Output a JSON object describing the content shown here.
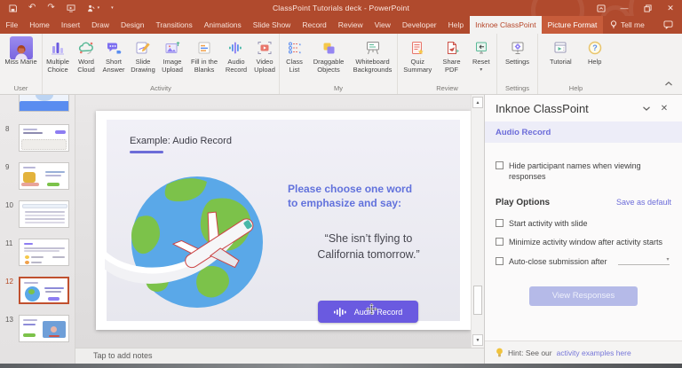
{
  "titlebar": {
    "title": "ClassPoint Tutorials deck  -  PowerPoint"
  },
  "tabs": {
    "items": [
      "File",
      "Home",
      "Insert",
      "Draw",
      "Design",
      "Transitions",
      "Animations",
      "Slide Show",
      "Record",
      "Review",
      "View",
      "Developer",
      "Help",
      "Inknoe ClassPoint",
      "Picture Format"
    ],
    "tellme": "Tell me"
  },
  "ribbon": {
    "group_labels": [
      "User",
      "Activity",
      "My",
      "Review",
      "Settings",
      "Help"
    ],
    "user": {
      "name": "Miss Marie"
    },
    "activity": [
      "Multiple Choice",
      "Word Cloud",
      "Short Answer",
      "Slide Drawing",
      "Image Upload",
      "Fill in the Blanks",
      "Audio Record",
      "Video Upload"
    ],
    "my": [
      "Class List",
      "Draggable Objects",
      "Whiteboard Backgrounds"
    ],
    "review": [
      "Quiz Summary",
      "Share PDF",
      "Reset"
    ],
    "settings": [
      "Settings"
    ],
    "help": [
      "Tutorial",
      "Help"
    ]
  },
  "thumbnails": {
    "numbers": [
      "8",
      "9",
      "10",
      "11",
      "12",
      "13"
    ],
    "selected": "12"
  },
  "slide": {
    "title": "Example: Audio Record",
    "heading_line1": "Please choose one word",
    "heading_line2": "to emphasize and say:",
    "quote_line1": "“She isn’t flying to",
    "quote_line2": "California tomorrow.”",
    "button_label": "Audio Record"
  },
  "notes": {
    "placeholder": "Tap to add notes"
  },
  "taskpane": {
    "title": "Inknoe ClassPoint",
    "section_title": "Audio Record",
    "hide_names_label": "Hide participant names when viewing responses",
    "play_options_title": "Play Options",
    "save_default_link": "Save as default",
    "options": [
      "Start activity with slide",
      "Minimize activity window after activity starts",
      "Auto-close submission after"
    ],
    "view_responses_label": "View Responses",
    "hint_prefix": "Hint: See our ",
    "hint_link": "activity examples here"
  },
  "colors": {
    "titlebar": "#b04a2d",
    "accent": "#6c6cd9",
    "slide_button": "#6a5ae0",
    "selection": "#c0502e"
  }
}
